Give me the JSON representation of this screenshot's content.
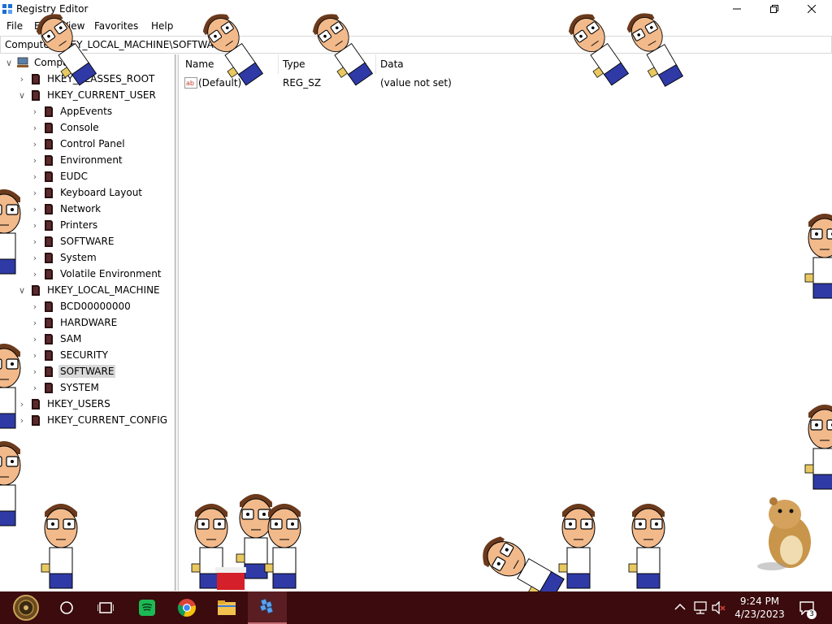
{
  "window": {
    "title": "Registry Editor",
    "menu": [
      "File",
      "Edit",
      "View",
      "Favorites",
      "Help"
    ],
    "address": "Computer\\HKEY_LOCAL_MACHINE\\SOFTWARE"
  },
  "tree": {
    "root": "Computer",
    "items": [
      {
        "label": "HKEY_CLASSES_ROOT",
        "level": 1,
        "expanded": false
      },
      {
        "label": "HKEY_CURRENT_USER",
        "level": 1,
        "expanded": true
      },
      {
        "label": "AppEvents",
        "level": 2,
        "expanded": false
      },
      {
        "label": "Console",
        "level": 2,
        "expanded": false
      },
      {
        "label": "Control Panel",
        "level": 2,
        "expanded": false
      },
      {
        "label": "Environment",
        "level": 2,
        "expanded": false
      },
      {
        "label": "EUDC",
        "level": 2,
        "expanded": false
      },
      {
        "label": "Keyboard Layout",
        "level": 2,
        "expanded": false
      },
      {
        "label": "Network",
        "level": 2,
        "expanded": false
      },
      {
        "label": "Printers",
        "level": 2,
        "expanded": false
      },
      {
        "label": "SOFTWARE",
        "level": 2,
        "expanded": false
      },
      {
        "label": "System",
        "level": 2,
        "expanded": false
      },
      {
        "label": "Volatile Environment",
        "level": 2,
        "expanded": false
      },
      {
        "label": "HKEY_LOCAL_MACHINE",
        "level": 1,
        "expanded": true
      },
      {
        "label": "BCD00000000",
        "level": 2,
        "expanded": false
      },
      {
        "label": "HARDWARE",
        "level": 2,
        "expanded": false
      },
      {
        "label": "SAM",
        "level": 2,
        "expanded": false
      },
      {
        "label": "SECURITY",
        "level": 2,
        "expanded": false
      },
      {
        "label": "SOFTWARE",
        "level": 2,
        "expanded": false,
        "selected": true
      },
      {
        "label": "SYSTEM",
        "level": 2,
        "expanded": false
      },
      {
        "label": "HKEY_USERS",
        "level": 1,
        "expanded": false
      },
      {
        "label": "HKEY_CURRENT_CONFIG",
        "level": 1,
        "expanded": false
      }
    ]
  },
  "list": {
    "columns": [
      "Name",
      "Type",
      "Data"
    ],
    "rows": [
      {
        "name": "(Default)",
        "type": "REG_SZ",
        "data": "(value not set)",
        "icon": "string-value-icon"
      }
    ]
  },
  "taskbar": {
    "apps": [
      "start-button",
      "search-button",
      "task-view-button",
      "spotify-app",
      "chrome-app",
      "file-explorer-app",
      "registry-editor-app"
    ],
    "time": "9:24 PM",
    "date": "4/23/2023",
    "notification_count": "3"
  },
  "colors": {
    "taskbar": "#3b0b0d",
    "folder": "#2a0f10",
    "selected": "#d9d9d9"
  }
}
